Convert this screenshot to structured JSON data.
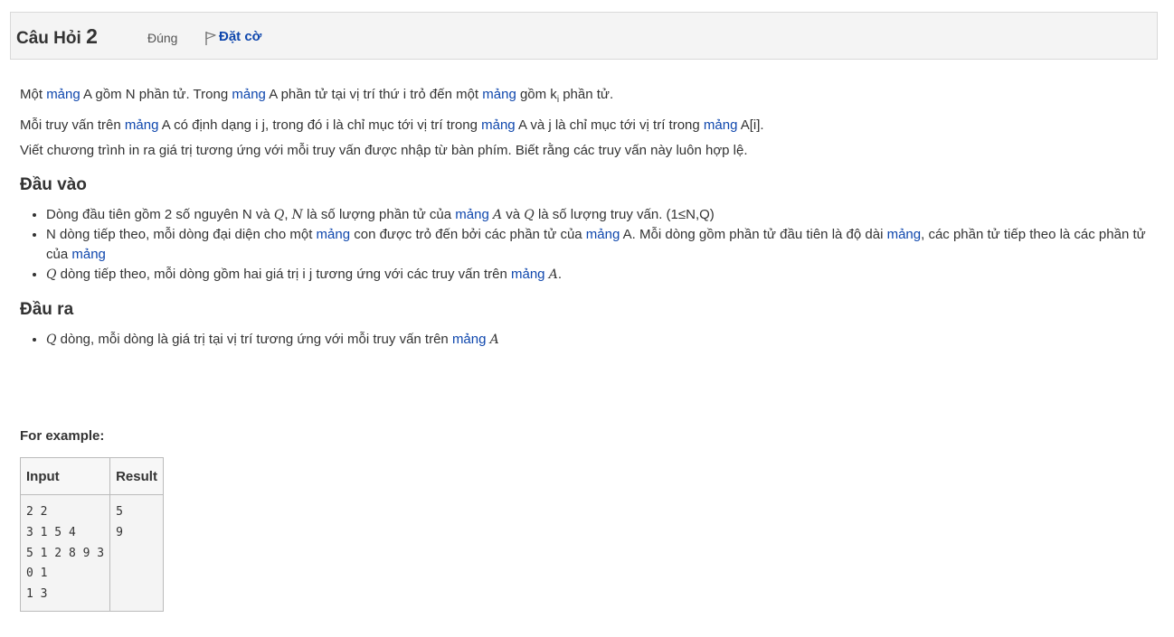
{
  "header": {
    "title_prefix": "Câu Hỏi",
    "question_number": "2",
    "status": "Đúng",
    "flag_label": "Đặt cờ"
  },
  "description": {
    "line1": [
      "Một ",
      "mảng",
      " A gồm N phần tử. Trong ",
      "mảng",
      " A phần tử tại vị trí thứ i trỏ đến một ",
      "mảng",
      " gồm k",
      "i",
      " phần tử."
    ],
    "line2": [
      "Mỗi truy vấn trên ",
      "mảng",
      " A có định dạng i j, trong đó i là chỉ mục tới vị trí trong ",
      "mảng",
      " A và j là chỉ mục tới vị trí trong ",
      "mảng",
      " A[i]."
    ],
    "line3": "Viết chương trình in ra giá trị tương ứng với mỗi truy vấn được nhập từ bàn phím. Biết rằng các truy vấn này luôn hợp lệ."
  },
  "input_section": {
    "heading": "Đầu vào",
    "item1": [
      "Dòng đầu tiên gồm 2 số nguyên N và ",
      "Q",
      ", ",
      "N",
      " là số lượng phần tử của ",
      "mảng",
      " ",
      "A",
      " và ",
      "Q",
      " là số lượng truy vấn. (1≤N,Q)"
    ],
    "item2": [
      "N dòng tiếp theo, mỗi dòng đại diện cho một ",
      "mảng",
      " con được trỏ đến bởi các phần tử của ",
      "mảng",
      " A. Mỗi dòng gồm phần tử đầu tiên là độ dài ",
      "mảng",
      ", các phần tử tiếp theo là các phần tử của ",
      "mảng"
    ],
    "item3": [
      "Q",
      " dòng tiếp theo, mỗi dòng gồm hai giá trị i j tương ứng với các truy vấn trên ",
      "mảng",
      " ",
      "A",
      "."
    ]
  },
  "output_section": {
    "heading": "Đầu ra",
    "item1": [
      "Q",
      " dòng, mỗi dòng là giá trị tại vị trí tương ứng với mỗi truy vấn trên ",
      "mảng",
      " ",
      "A"
    ]
  },
  "example": {
    "label": "For example:",
    "headers": [
      "Input",
      "Result"
    ],
    "input": "2 2\n3 1 5 4\n5 1 2 8 9 3\n0 1\n1 3",
    "result": "5\n9"
  },
  "colors": {
    "link": "#0f47ad",
    "header_bg": "#f4f4f4",
    "text": "#333333"
  }
}
